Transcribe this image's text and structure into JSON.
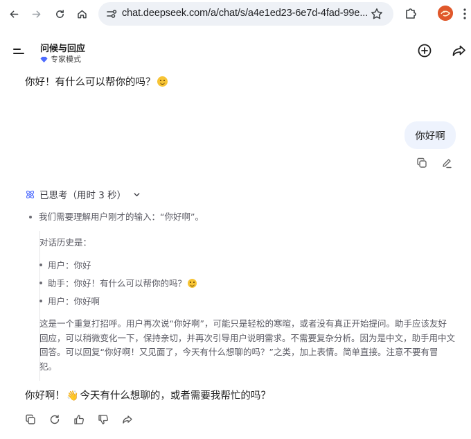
{
  "browser": {
    "url": "chat.deepseek.com/a/chat/s/a4e1ed23-6e7d-4fad-99e...",
    "icons": [
      "back-arrow-icon",
      "forward-arrow-icon",
      "reload-icon",
      "home-icon",
      "site-settings-icon",
      "bookmark-star-icon",
      "extensions-icon",
      "profile-avatar",
      "more-menu-icon"
    ]
  },
  "header": {
    "title": "问候与回应",
    "mode_label": "专家模式",
    "icons": [
      "sidebar-menu-icon",
      "new-chat-icon",
      "share-icon"
    ]
  },
  "conversation": {
    "assistant_greeting": "你好！有什么可以帮你的吗？",
    "user_message": "你好啊",
    "thought_status": "已思考（用时 3 秒）",
    "thinking": {
      "first_line": "我们需要理解用户刚才的输入：“你好啊”。",
      "history_label": "对话历史是：",
      "history_items": [
        "用户：你好",
        "助手：你好！有什么可以帮你的吗？",
        "用户：你好啊"
      ],
      "paragraph": "这是一个重复打招呼。用户再次说“你好啊”，可能只是轻松的寒暄，或者没有真正开始提问。助手应该友好回应，可以稍微变化一下，保持亲切，并再次引导用户说明需求。不需要复杂分析。因为是中文，助手用中文回答。可以回复“你好啊！又见面了，今天有什么想聊的吗？”之类，加上表情。简单直接。注意不要有冒犯。"
    },
    "assistant_reply_before": "你好啊！",
    "assistant_reply_after": "今天有什么想聊的，或者需要我帮忙的吗？"
  },
  "colors": {
    "accent_blue": "#4d6bfe",
    "user_bubble": "#eef3fd",
    "url_bar": "#eef1f6"
  }
}
